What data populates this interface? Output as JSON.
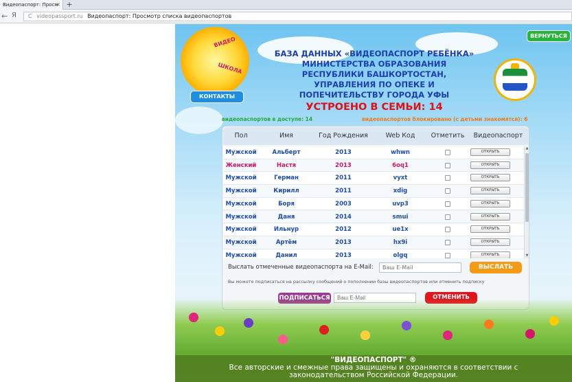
{
  "browser": {
    "tab_title": "Видеопаспорт: Просм",
    "tab_close": "×",
    "new_tab": "+",
    "back": "←",
    "ya": "Я",
    "reload": "C",
    "url_domain": "videopassport.ru",
    "url_title": "Видеопаспорт: Просмотр списка видеопаспортов"
  },
  "header": {
    "logo_top": "ВИДЕО",
    "logo_bottom": "ШКОЛА",
    "back_button": "ВЕРНУТЬСЯ",
    "contacts_button": "КОНТАКТЫ",
    "org_title": "БАЗА ДАННЫХ «ВИДЕОПАСПОРТ РЕБЁНКА» МИНИСТЕРСТВА ОБРАЗОВАНИЯ РЕСПУБЛИКИ БАШКОРТОСТАН, УПРАВЛЕНИЯ ПО ОПЕКЕ И ПОПЕЧИТЕЛЬСТВУ ГОРОДА УФЫ"
  },
  "stats": {
    "adopted": "УСТРОЕНО В СЕМЬИ: 14",
    "available": "видеопаспортов в доступе: 14",
    "blocked": "видеопаспортов блокировано (с детьми знакомятся): 6"
  },
  "table": {
    "columns": [
      "Пол",
      "Имя",
      "Год Рождения",
      "Web Код",
      "Отметить",
      "Видеопаспорт"
    ],
    "open_label": "ОТКРЫТЬ",
    "rows": [
      {
        "gender": "Мужской",
        "name": "Альберт",
        "year": "2013",
        "code": "whwn"
      },
      {
        "gender": "Женский",
        "name": "Настя",
        "year": "2013",
        "code": "6oq1"
      },
      {
        "gender": "Мужской",
        "name": "Герман",
        "year": "2011",
        "code": "vyxt"
      },
      {
        "gender": "Мужской",
        "name": "Кирилл",
        "year": "2011",
        "code": "xdig"
      },
      {
        "gender": "Мужской",
        "name": "Боря",
        "year": "2003",
        "code": "uvp3"
      },
      {
        "gender": "Мужской",
        "name": "Даня",
        "year": "2014",
        "code": "smui"
      },
      {
        "gender": "Мужской",
        "name": "Ильнур",
        "year": "2012",
        "code": "ue1x"
      },
      {
        "gender": "Мужской",
        "name": "Артём",
        "year": "2013",
        "code": "hx9i"
      },
      {
        "gender": "Мужской",
        "name": "Данил",
        "year": "2013",
        "code": "olgq"
      }
    ]
  },
  "send": {
    "label": "Выслать отмеченные видеопаспорта на E-Mail:",
    "placeholder": "Ваш E-Mail",
    "button": "ВЫСЛАТЬ"
  },
  "subscribe": {
    "note": "Вы можете подписаться на рассылку сообщений о пополнении базы видеопаспортов или отменить подписку",
    "button": "ПОДПИСАТЬСЯ",
    "placeholder": "Ваш E-Mail",
    "cancel": "ОТМЕНИТЬ"
  },
  "footer": {
    "title": "\"ВИДЕОПАСПОРТ\" ®",
    "line1": "Все авторские и смежные права защищены и охраняются в соответствии с",
    "line2": "законодательством Российской Федерации."
  },
  "colors": {
    "male": "#1c4bb5",
    "female": "#d4156a"
  }
}
